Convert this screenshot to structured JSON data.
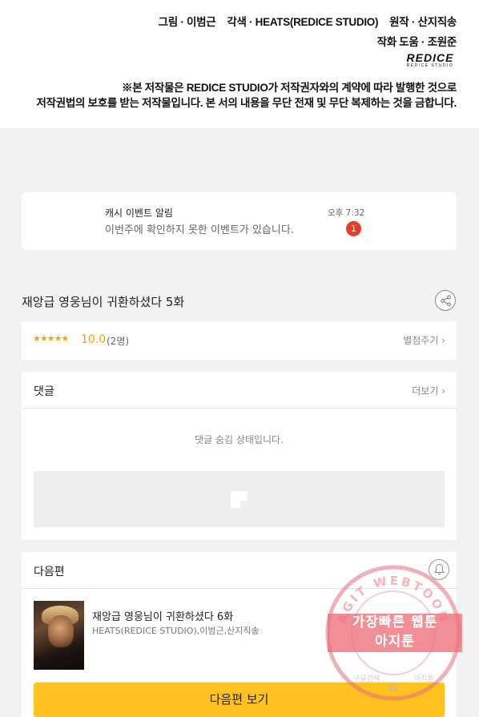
{
  "credits": {
    "line1_art": "그림 · 이범근",
    "line1_adapt": "각색 · HEATS(REDICE STUDIO)",
    "line1_original": "원작 · 산지직송",
    "line2": "작화 도움 · 조원준",
    "logo_big": "REDICE",
    "logo_small": "REDICE STUDIO",
    "notice1": "※본 저작물은 REDICE STUDIO가 저작권자와의 계약에 따라 발행한 것으로",
    "notice2": "저작권법의 보호를 받는 저작물입니다. 본 서의 내용을 무단 전재 및 무단 복제하는 것을 금합니다."
  },
  "notification": {
    "title": "캐시 이벤트 알림",
    "message": "이번주에 확인하지 못한 이벤트가 있습니다.",
    "time": "오후 7:32",
    "badge": "1"
  },
  "episode": {
    "title": "재앙급 영웅님이 귀환하셨다 5화",
    "share_icon": "share-icon"
  },
  "rating": {
    "stars": "★★★★★",
    "score": "10.0",
    "count": "(2명)",
    "rate_label": "별점주기 ›"
  },
  "comments": {
    "label": "댓글",
    "more_label": "더보기 ›",
    "hidden_message": "댓글 숨김 상태입니다."
  },
  "next_episode": {
    "section_label": "다음편",
    "bell_icon": "bell-icon",
    "title": "재앙급 영웅님이 귀환하셨다 6화",
    "authors": "HEATS(REDICE STUDIO),이범근,산지직송",
    "button_label": "다음편 보기"
  },
  "watermark": {
    "arc_text": "AGIT WEBTOON",
    "line1": "가장빠른 웹툰",
    "line2": "아지툰",
    "bottom_left": "구글검색",
    "bottom_right": "아지툰"
  },
  "colors": {
    "accent_yellow": "#ffc21f",
    "star_orange": "#f4a300",
    "badge_red": "#e0412b",
    "watermark_pink": "#e4707c"
  }
}
